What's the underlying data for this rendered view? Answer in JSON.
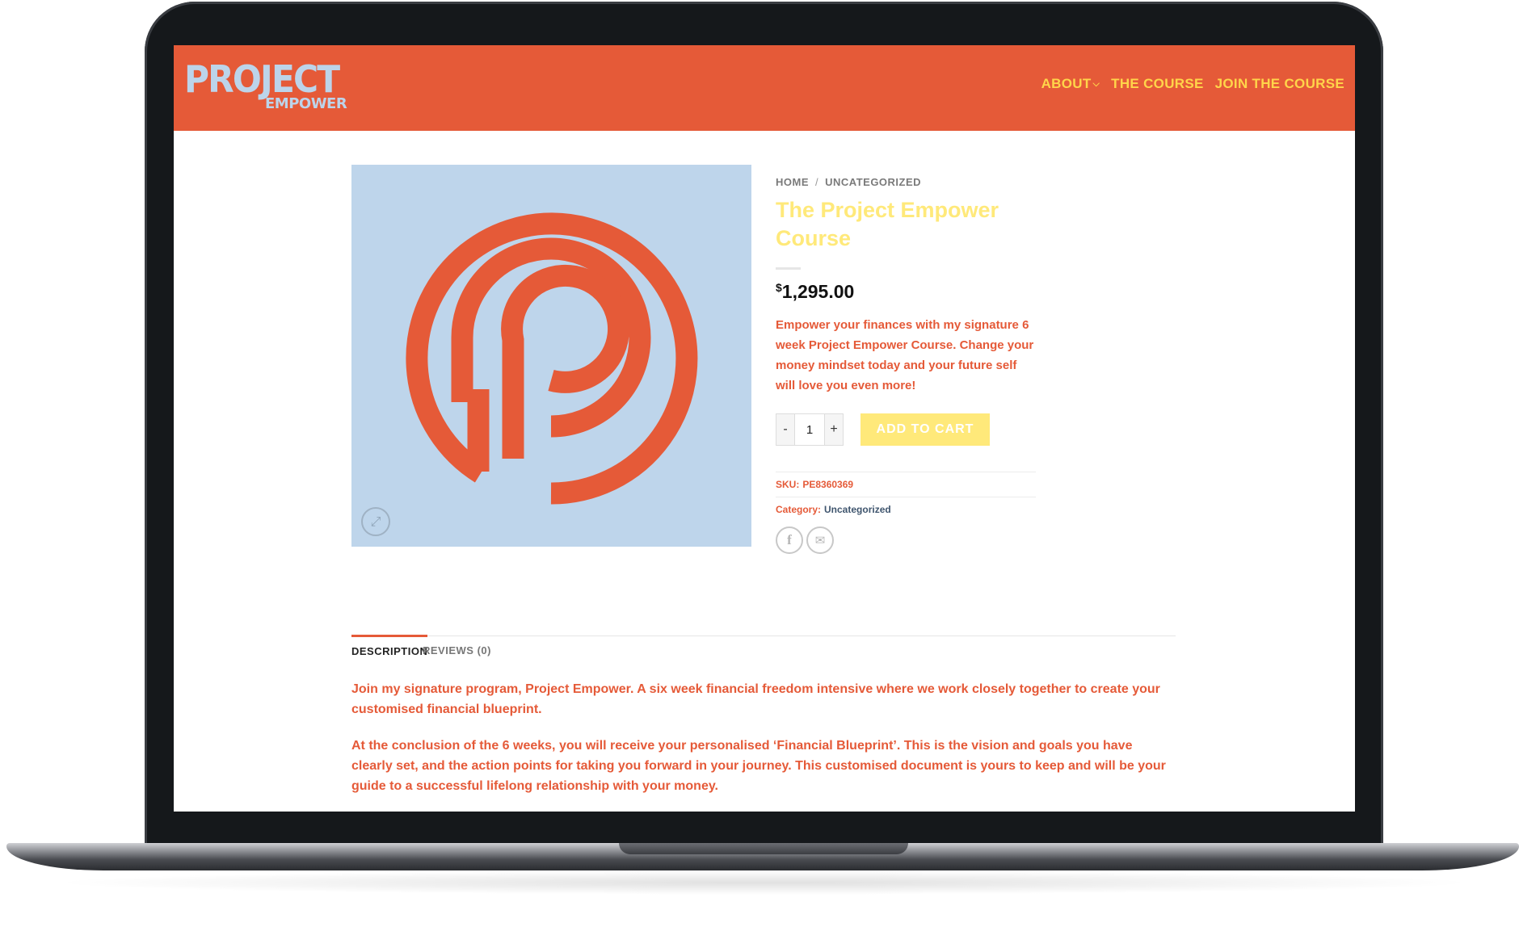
{
  "colors": {
    "brand_orange": "#e55a38",
    "nav_yellow": "#ffd54a",
    "title_yellow": "#ffe97a",
    "image_blue": "#bed5eb",
    "link_blue": "#3f556e"
  },
  "header": {
    "logo_main": "PROJECT",
    "logo_sub": "EMPOWER",
    "nav": [
      {
        "label": "ABOUT",
        "icon": "chevron-down-icon"
      },
      {
        "label": "THE COURSE"
      },
      {
        "label": "JOIN THE COURSE"
      }
    ]
  },
  "breadcrumb": {
    "home": "HOME",
    "separator": "/",
    "category": "UNCATEGORIZED"
  },
  "product": {
    "title": "The Project Empower Course",
    "currency": "$",
    "price": "1,295.00",
    "short_description": "Empower your finances with my signature 6 week Project Empower Course. Change your money mindset today and your future self will love you even more!",
    "quantity_minus": "-",
    "quantity_value": "1",
    "quantity_plus": "+",
    "add_to_cart": "ADD TO CART",
    "sku_label": "SKU:",
    "sku_value": "PE8360369",
    "category_label": "Category:",
    "category_value": "Uncategorized",
    "image_icon": "p-logo-icon",
    "zoom_icon": "expand-icon",
    "share_icons": [
      "facebook-icon",
      "email-icon"
    ]
  },
  "tabs": [
    {
      "label": "DESCRIPTION",
      "active": true
    },
    {
      "label": "REVIEWS (0)",
      "active": false
    }
  ],
  "description": [
    "Join my signature program, Project Empower. A six week financial freedom intensive where we work closely together to create your customised financial blueprint.",
    "At the conclusion of the 6 weeks, you will receive your personalised ‘Financial Blueprint’. This is the vision and goals you have clearly set, and the action points for taking you forward in your journey. This customised document is yours to keep and will be your guide to a successful lifelong relationship with your money."
  ]
}
